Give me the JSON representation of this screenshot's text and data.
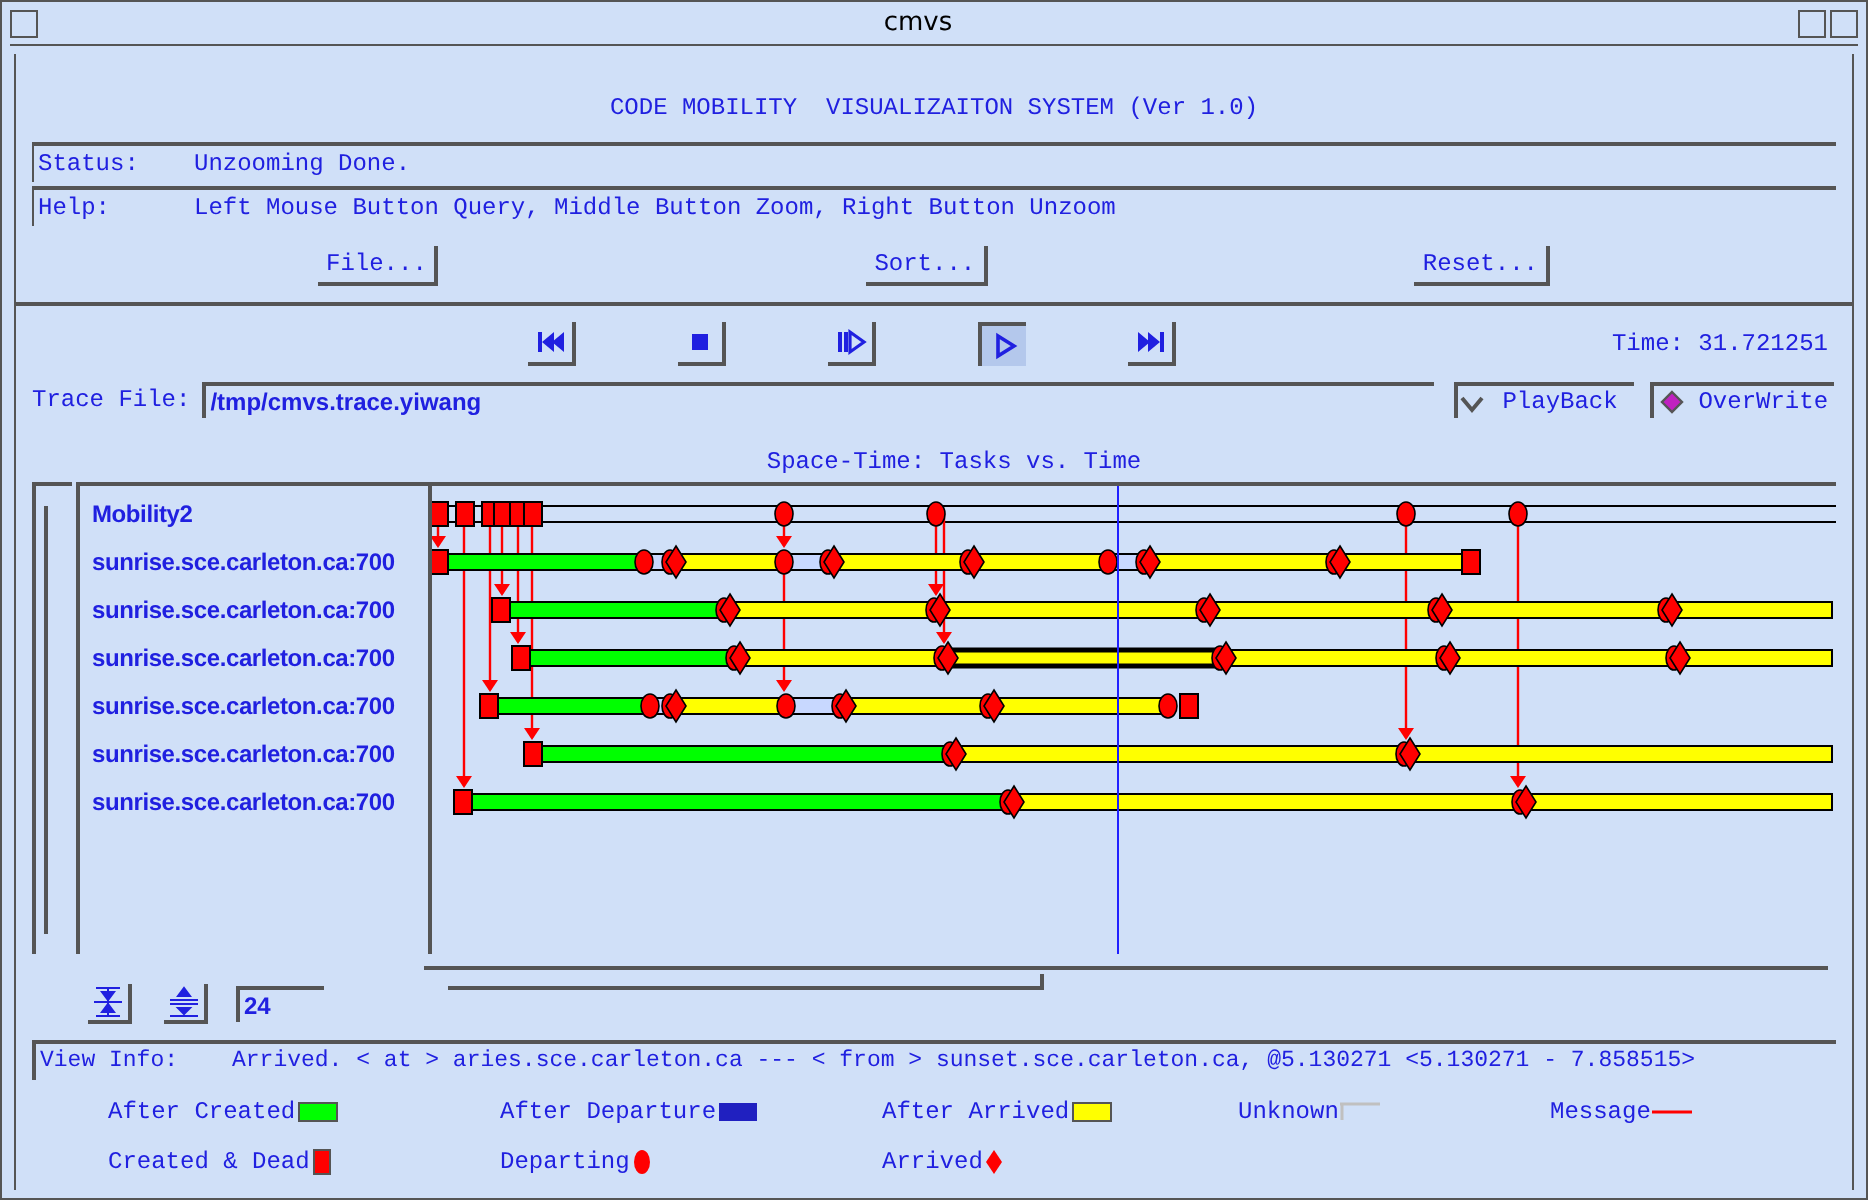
{
  "window": {
    "title": "cmvs"
  },
  "header": "CODE MOBILITY  VISUALIZAITON SYSTEM (Ver 1.0)",
  "status": {
    "label": "Status:",
    "value": "Unzooming Done."
  },
  "help": {
    "label": "Help:",
    "value": "Left Mouse Button Query, Middle Button Zoom, Right Button Unzoom"
  },
  "menu_buttons": [
    "File...",
    "Sort...",
    "Reset..."
  ],
  "transport": [
    {
      "kind": "rewind",
      "selected": false
    },
    {
      "kind": "stop",
      "selected": false
    },
    {
      "kind": "step",
      "selected": false
    },
    {
      "kind": "play",
      "selected": true
    },
    {
      "kind": "forward",
      "selected": false
    }
  ],
  "time": "Time: 31.721251",
  "trace_file": {
    "label": "Trace File:",
    "value": "/tmp/cmvs.trace.yiwang"
  },
  "playback": {
    "label": "PlayBack",
    "checked": true
  },
  "overwrite": {
    "label": "OverWrite",
    "selected": true
  },
  "chart_title": "Space-Time: Tasks vs. Time",
  "tasks": [
    "Mobility2",
    "sunrise.sce.carleton.ca:700",
    "sunrise.sce.carleton.ca:700",
    "sunrise.sce.carleton.ca:700",
    "sunrise.sce.carleton.ca:700",
    "sunrise.sce.carleton.ca:700",
    "sunrise.sce.carleton.ca:700"
  ],
  "zoom_value": "24",
  "view_info": {
    "label": "View Info:",
    "value": "Arrived. < at > aries.sce.carleton.ca --- < from > sunset.sce.carleton.ca, @5.130271 <5.130271 - 7.858515>"
  },
  "legend": [
    {
      "label": "After Created",
      "kind": "bar",
      "color": "#00ff00"
    },
    {
      "label": "After Departure",
      "kind": "dotted",
      "color": "#2020c0"
    },
    {
      "label": "After Arrived",
      "kind": "bar",
      "color": "#ffff00"
    },
    {
      "label": "Unknown",
      "kind": "outline",
      "color": "#c0c0c0"
    },
    {
      "label": "Message",
      "kind": "line",
      "color": "#ff0000"
    },
    {
      "label": "Created & Dead",
      "kind": "square",
      "color": "#ff0000"
    },
    {
      "label": "Departing",
      "kind": "circle",
      "color": "#ff0000"
    },
    {
      "label": "Arrived",
      "kind": "diamond",
      "color": "#ff0000"
    }
  ]
}
